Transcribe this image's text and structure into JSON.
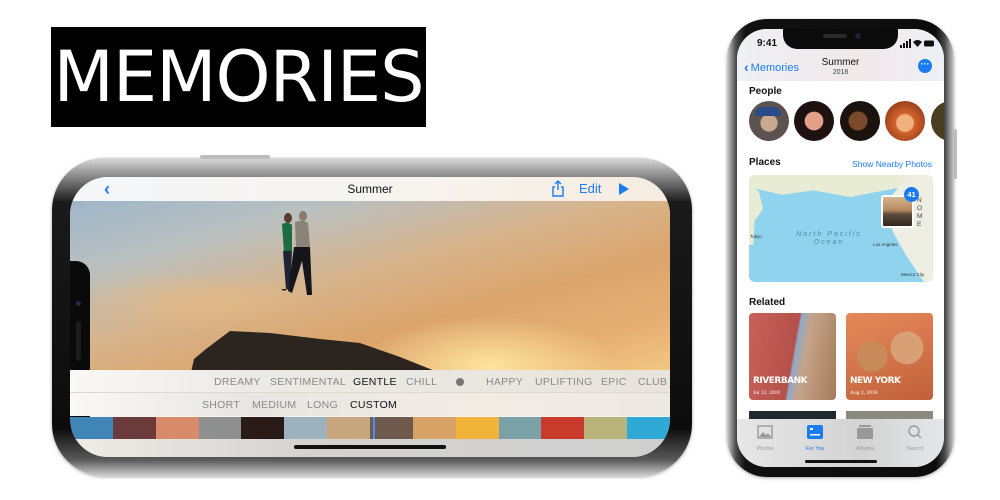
{
  "banner": {
    "title": "MEMORIES"
  },
  "landscape": {
    "nav": {
      "back_icon": "chevron-left-icon",
      "title": "Summer",
      "share_icon": "share-icon",
      "edit_label": "Edit",
      "play_icon": "play-icon"
    },
    "moods": [
      {
        "label": "DREAMY",
        "selected": false
      },
      {
        "label": "SENTIMENTAL",
        "selected": false
      },
      {
        "label": "GENTLE",
        "selected": true
      },
      {
        "label": "CHILL",
        "selected": false
      },
      {
        "label": "HAPPY",
        "selected": false
      },
      {
        "label": "UPLIFTING",
        "selected": false
      },
      {
        "label": "EPIC",
        "selected": false
      },
      {
        "label": "CLUB",
        "selected": false
      }
    ],
    "lengths": [
      {
        "label": "SHORT",
        "selected": false
      },
      {
        "label": "MEDIUM",
        "selected": false
      },
      {
        "label": "LONG",
        "selected": false
      },
      {
        "label": "CUSTOM",
        "selected": true
      }
    ],
    "strip_colors": [
      "#3f86b6",
      "#6b3a3a",
      "#d98a6a",
      "#8e9090",
      "#2a1a18",
      "#9db1bf",
      "#c7a57d",
      "#6e5a4c",
      "#d7a265",
      "#f0b43a",
      "#7aa0a8",
      "#c83a2c",
      "#b8b37a",
      "#2fa9d6"
    ]
  },
  "portrait": {
    "status": {
      "time": "9:41"
    },
    "nav": {
      "back_label": "Memories",
      "title": "Summer",
      "subtitle": "2018",
      "more_icon": "ellipsis-icon"
    },
    "people": {
      "heading": "People",
      "avatars": [
        {
          "name": "person-1",
          "color": "#5a5350"
        },
        {
          "name": "person-2",
          "color": "#3a2420"
        },
        {
          "name": "person-3",
          "color": "#2c1d14"
        },
        {
          "name": "person-4",
          "color": "#c86a3a"
        },
        {
          "name": "person-5",
          "color": "#6a5a2a"
        }
      ]
    },
    "places": {
      "heading": "Places",
      "link": "Show Nearby Photos",
      "map": {
        "ocean_line1": "North Pacific",
        "ocean_line2": "Ocean",
        "label_tokyo": "Tokyo",
        "label_la": "Los Angeles",
        "label_mexico": "Mexico City",
        "label_noam_1": "N O",
        "label_noam_2": "M E",
        "photo_count": "41"
      }
    },
    "related": {
      "heading": "Related",
      "cards": [
        {
          "title": "RIVERBANK",
          "date": "Jul 12, 2018"
        },
        {
          "title": "NEW YORK",
          "date": "Aug 2, 2018"
        }
      ]
    },
    "tabs": [
      {
        "label": "Photos",
        "icon": "photos-icon",
        "active": false
      },
      {
        "label": "For You",
        "icon": "for-you-icon",
        "active": true
      },
      {
        "label": "Albums",
        "icon": "albums-icon",
        "active": false
      },
      {
        "label": "Search",
        "icon": "search-icon",
        "active": false
      }
    ]
  }
}
